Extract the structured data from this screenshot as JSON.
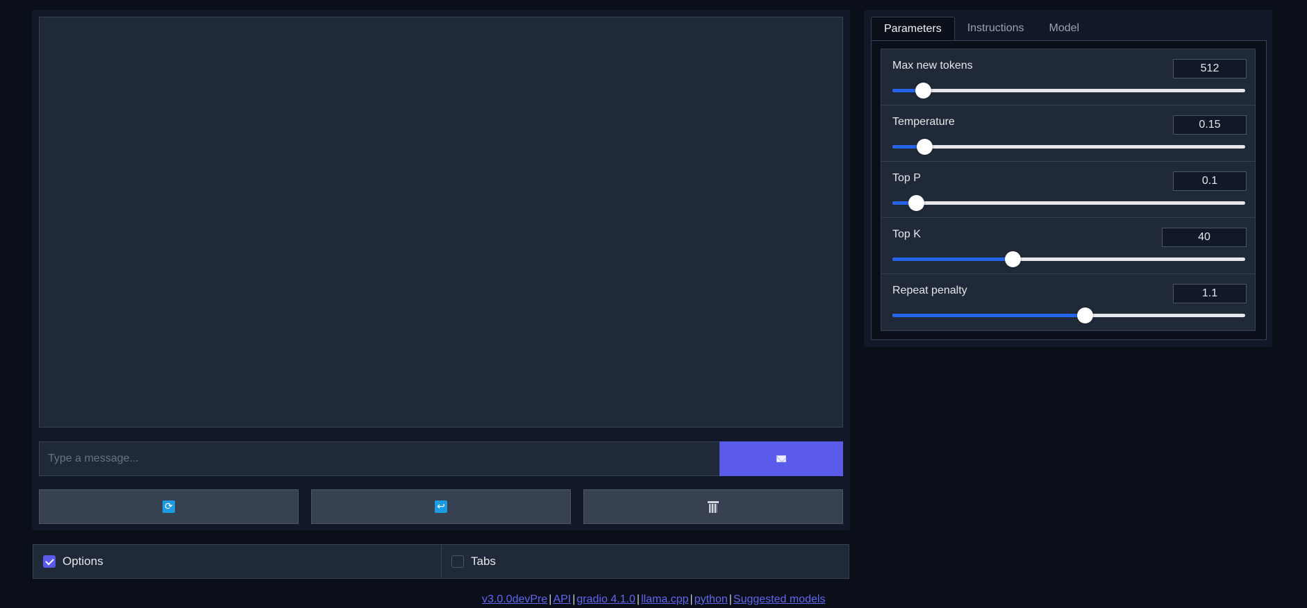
{
  "chat": {
    "input_placeholder": "Type a message...",
    "send_icon": "envelope-icon",
    "actions": [
      {
        "name": "regenerate",
        "icon": "arrows-cycle-icon"
      },
      {
        "name": "undo",
        "icon": "return-arrow-icon"
      },
      {
        "name": "clear",
        "icon": "wastebasket-icon"
      }
    ]
  },
  "options_bar": {
    "options": {
      "label": "Options",
      "checked": true
    },
    "tabs": {
      "label": "Tabs",
      "checked": false
    }
  },
  "footer": {
    "links": [
      "v3.0.0devPre",
      "API",
      "gradio 4.1.0",
      "llama.cpp",
      "python",
      "Suggested models"
    ],
    "separator": "|"
  },
  "right_panel": {
    "tabs": [
      "Parameters",
      "Instructions",
      "Model"
    ],
    "active_tab": "Parameters",
    "parameters": [
      {
        "label": "Max new tokens",
        "value": "512",
        "fraction": 0.087
      },
      {
        "label": "Temperature",
        "value": "0.15",
        "fraction": 0.09
      },
      {
        "label": "Top P",
        "value": "0.1",
        "fraction": 0.066
      },
      {
        "label": "Top K",
        "value": "40",
        "fraction": 0.34
      },
      {
        "label": "Repeat penalty",
        "value": "1.1",
        "fraction": 0.545
      }
    ]
  },
  "colors": {
    "accent": "#5b5bea",
    "slider_fill": "#2563eb",
    "link": "#6366f1"
  }
}
